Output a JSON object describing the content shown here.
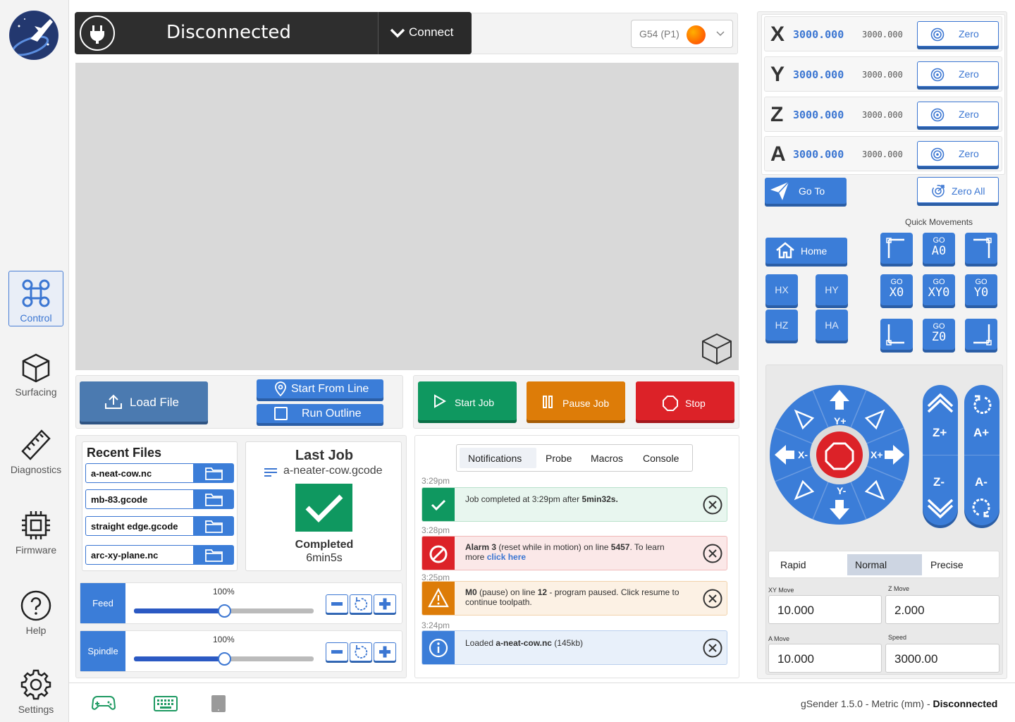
{
  "sidebar": {
    "items": [
      {
        "label": "Control",
        "icon": "command-icon"
      },
      {
        "label": "Surfacing",
        "icon": "cube-icon"
      },
      {
        "label": "Diagnostics",
        "icon": "ruler-icon"
      },
      {
        "label": "Firmware",
        "icon": "chip-icon"
      },
      {
        "label": "Help",
        "icon": "help-icon"
      },
      {
        "label": "Settings",
        "icon": "gear-icon"
      }
    ]
  },
  "connection": {
    "status": "Disconnected",
    "connect_label": "Connect"
  },
  "workspace": {
    "selected": "G54 (P1)"
  },
  "toolbar": {
    "load_file": "Load File",
    "start_from_line": "Start From Line",
    "run_outline": "Run Outline",
    "start_job": "Start Job",
    "pause_job": "Pause Job",
    "stop": "Stop"
  },
  "recent_files": {
    "title": "Recent Files",
    "files": [
      "a-neat-cow.nc",
      "mb-83.gcode",
      "straight edge.gcode",
      "arc-xy-plane.nc"
    ]
  },
  "last_job": {
    "title": "Last Job",
    "file": "a-neater-cow.gcode",
    "status": "Completed",
    "duration": "6min5s"
  },
  "overrides": {
    "feed": {
      "label": "Feed",
      "percent": "100%",
      "level": 0.5
    },
    "spindle": {
      "label": "Spindle",
      "percent": "100%",
      "level": 0.5
    }
  },
  "tabs": [
    "Notifications",
    "Probe",
    "Macros",
    "Console"
  ],
  "notifications": [
    {
      "time": "3:29pm",
      "type": "success",
      "pre": "Job completed at 3:29pm after ",
      "bold": "5min32s.",
      "post": ""
    },
    {
      "time": "3:28pm",
      "type": "error",
      "bold": "Alarm 3",
      "pre": " (reset while in motion) on line ",
      "bold2": "5457",
      "post": ".  To learn more ",
      "link": "click here"
    },
    {
      "time": "3:25pm",
      "type": "warning",
      "bold": "M0",
      "pre": " (pause) on line ",
      "bold2": "12",
      "post": " - program paused.  Click resume to continue toolpath."
    },
    {
      "time": "3:24pm",
      "type": "info",
      "pre": "Loaded ",
      "bold": "a-neat-cow.nc",
      "post": " (145kb)"
    }
  ],
  "dro": {
    "axes": [
      {
        "letter": "X",
        "work": "3000.000",
        "machine": "3000.000",
        "zero_label": "Zero"
      },
      {
        "letter": "Y",
        "work": "3000.000",
        "machine": "3000.000",
        "zero_label": "Zero"
      },
      {
        "letter": "Z",
        "work": "3000.000",
        "machine": "3000.000",
        "zero_label": "Zero"
      },
      {
        "letter": "A",
        "work": "3000.000",
        "machine": "3000.000",
        "zero_label": "Zero"
      }
    ],
    "go_to": "Go To",
    "zero_all": "Zero All"
  },
  "quick": {
    "title": "Quick Movements",
    "home": "Home",
    "homes": [
      "HX",
      "HY",
      "HZ",
      "HA"
    ],
    "go_label": "GO",
    "go": [
      "A0",
      "X0",
      "XY0",
      "Y0",
      "Z0"
    ]
  },
  "jog": {
    "xm": "X-",
    "xp": "X+",
    "yp": "Y+",
    "ym": "Y-",
    "zp": "Z+",
    "zm": "Z-",
    "ap": "A+",
    "am": "A-",
    "speeds": [
      "Rapid",
      "Normal",
      "Precise"
    ],
    "selected_speed": "Normal",
    "xy_label": "XY Move",
    "xy_value": "10.000",
    "z_label": "Z Move",
    "z_value": "2.000",
    "a_label": "A Move",
    "a_value": "10.000",
    "speed_label": "Speed",
    "speed_value": "3000.00"
  },
  "footer": {
    "version": "gSender 1.5.0 - Metric (mm) - ",
    "status": "Disconnected"
  },
  "colors": {
    "accent": "#3b7dd8",
    "green": "#0f9860",
    "orange": "#dd7c08",
    "red": "#dc2228"
  }
}
